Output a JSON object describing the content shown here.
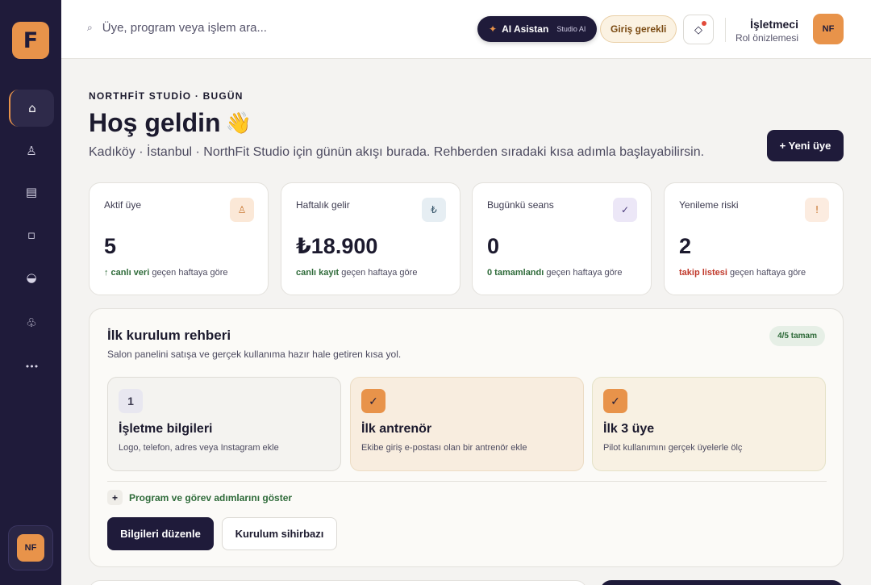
{
  "app": {
    "logo_letter": "F"
  },
  "colors": {
    "brand": "#e8934a",
    "sidebar": "#1f1b3a",
    "accent_green": "#2f6b3a",
    "accent_red": "#c0392b"
  },
  "sidebar": {
    "items": [
      {
        "name": "home-icon",
        "glyph": "⌂",
        "active": true
      },
      {
        "name": "user-icon",
        "glyph": "♙"
      },
      {
        "name": "calendar-icon",
        "glyph": "▤"
      },
      {
        "name": "square-icon",
        "glyph": "▫"
      },
      {
        "name": "chart-icon",
        "glyph": "◒"
      },
      {
        "name": "club-icon",
        "glyph": "♧"
      },
      {
        "name": "more-icon",
        "glyph": "•••"
      }
    ],
    "avatar": "NF"
  },
  "topbar": {
    "search_placeholder": "Üye, program veya işlem ara...",
    "search_icon": "⌕",
    "ai_label": "AI Asistan",
    "ai_sub": "Studio AI",
    "ai_spark": "✦",
    "login_label": "Giriş gerekli",
    "notification_icon": "◇",
    "user_name": "İşletmeci",
    "user_role": "Rol önizlemesi",
    "avatar": "NF"
  },
  "header": {
    "kicker": "NORTHFİT STUDİO · BUGÜN",
    "title": "Hoş geldin",
    "title_emoji": "👋",
    "subtitle": "Kadıköy · İstanbul · NorthFit Studio için günün akışı burada. Rehberden sıradaki kısa adımla başlayabilirsin.",
    "new_member_button": "+ Yeni üye"
  },
  "stats": [
    {
      "label": "Aktif üye",
      "icon": "♙",
      "icon_bg": "#fbe8d7",
      "icon_color": "#c8752d",
      "value": "5",
      "hl": "↑ canlı veri",
      "hl_color": "#2f6b3a",
      "foot": " geçen haftaya göre"
    },
    {
      "label": "Haftalık gelir",
      "icon": "₺",
      "icon_bg": "#e6eef3",
      "icon_color": "#3c5a6e",
      "value": "₺18.900",
      "hl": "canlı kayıt",
      "hl_color": "#2f6b3a",
      "foot": " geçen haftaya göre"
    },
    {
      "label": "Bugünkü seans",
      "icon": "✓",
      "icon_bg": "#ece7f7",
      "icon_color": "#4a3a7a",
      "value": "0",
      "hl": "0 tamamlandı",
      "hl_color": "#2f6b3a",
      "foot": " geçen haftaya göre"
    },
    {
      "label": "Yenileme riski",
      "icon": "!",
      "icon_bg": "#fcece0",
      "icon_color": "#c8752d",
      "value": "2",
      "hl": "takip listesi",
      "hl_color": "#c0392b",
      "foot": " geçen haftaya göre"
    }
  ],
  "guide": {
    "title": "İlk kurulum rehberi",
    "subtitle": "Salon panelini satışa ve gerçek kullanıma hazır hale getiren kısa yol.",
    "progress": "4/5 tamam",
    "steps": [
      {
        "badge": "1",
        "title": "İşletme bilgileri",
        "desc": "Logo, telefon, adres veya Instagram ekle",
        "done": false
      },
      {
        "badge": "✓",
        "title": "İlk antrenör",
        "desc": "Ekibe giriş e-postası olan bir antrenör ekle",
        "done": true
      },
      {
        "badge": "✓",
        "title": "İlk 3 üye",
        "desc": "Pilot kullanımını gerçek üyelerle ölç",
        "done": true
      }
    ],
    "show_steps": "Program ve görev adımlarını göster",
    "plus": "+",
    "edit_button": "Bilgileri düzenle",
    "wizard_button": "Kurulum sihirbazı"
  }
}
